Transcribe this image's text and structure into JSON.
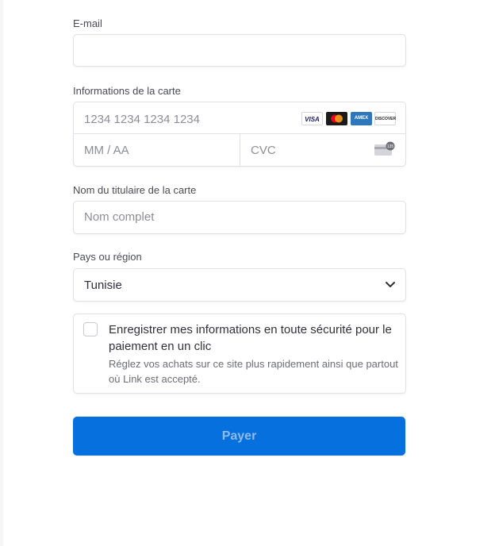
{
  "email": {
    "label": "E-mail",
    "value": ""
  },
  "card": {
    "label": "Informations de la carte",
    "number_placeholder": "1234 1234 1234 1234",
    "expiry_placeholder": "MM / AA",
    "cvc_placeholder": "CVC",
    "brands": [
      {
        "name": "visa-icon",
        "text": "VISA"
      },
      {
        "name": "mastercard-icon",
        "text": ""
      },
      {
        "name": "amex-icon",
        "text": "AMEX"
      },
      {
        "name": "discover-icon",
        "text": "DISCOVER"
      }
    ],
    "cvc_icon_text": "135"
  },
  "cardholder": {
    "label": "Nom du titulaire de la carte",
    "placeholder": "Nom complet"
  },
  "country": {
    "label": "Pays ou région",
    "selected": "Tunisie"
  },
  "save_info": {
    "checked": false,
    "title": "Enregistrer mes informations en toute sécurité pour le paiement en un clic",
    "description": "Réglez vos achats sur ce site plus rapidement ainsi que partout où Link est accepté."
  },
  "pay_button": {
    "label": "Payer"
  },
  "colors": {
    "button_bg": "#0570de",
    "button_text": "#8fbbef",
    "border": "#e0e0e6",
    "text": "#30313d",
    "placeholder": "#8d8e98"
  }
}
